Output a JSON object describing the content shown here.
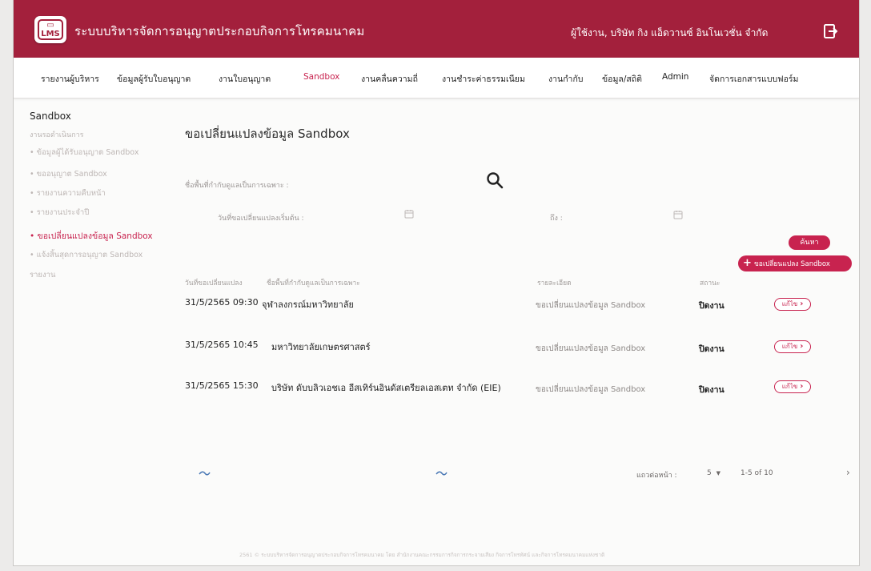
{
  "app": {
    "title": "ระบบบริหารจัดการอนุญาตประกอบกิจการโทรคมนาคม",
    "user": "ผู้ใช้งาน, บริษัท กิง แอ็ดวานซ์ อินโนเวชั่น จำกัด",
    "logo_text": "LMS"
  },
  "nav": {
    "items": [
      "รายงานผู้บริหาร",
      "ข้อมูลผู้รับใบอนุญาต",
      "งานใบอนุญาต",
      "Sandbox",
      "งานคลื่นความถี่",
      "งานชำระค่าธรรมเนียม",
      "งานกำกับ",
      "ข้อมูล/สถิติ",
      "Admin",
      "จัดการเอกสารแบบฟอร์ม"
    ],
    "active": "Sandbox"
  },
  "sidebar": {
    "title": "Sandbox",
    "section": "งานรอดำเนินการ",
    "items": [
      "• ข้อมูลผู้ได้รับอนุญาต Sandbox",
      "• ขออนุญาต Sandbox",
      "• รายงานความคืบหน้า",
      "• รายงานประจำปี",
      "• ขอเปลี่ยนแปลงข้อมูล Sandbox",
      "• แจ้งสิ้นสุดการอนุญาต Sandbox"
    ],
    "report": "รายงาน"
  },
  "main": {
    "title": "ขอเปลี่ยนแปลงข้อมูล Sandbox",
    "filters": {
      "area_label": "ชื่อพื้นที่กำกับดูแลเป็นการเฉพาะ :",
      "start_date_label": "วันที่ขอเปลี่ยนแปลงเริ่มต้น :",
      "end_date_label": "ถึง :"
    },
    "search_button": "ค้นหา",
    "add_button": "ขอเปลี่ยนแปลง Sandbox",
    "columns": [
      "วันที่ขอเปลี่ยนแปลง",
      "ชื่อพื้นที่กำกับดูแลเป็นการเฉพาะ",
      "รายละเอียด",
      "สถานะ"
    ],
    "rows": [
      {
        "date": "31/5/2565 09:30",
        "name": "จุฬาลงกรณ์มหาวิทยาลัย",
        "detail": "ขอเปลี่ยนแปลงข้อมูล Sandbox",
        "status": "ปิดงาน",
        "action": "แก้ไข"
      },
      {
        "date": "31/5/2565 10:45",
        "name": "มหาวิทยาลัยเกษตรศาสตร์",
        "detail": "ขอเปลี่ยนแปลงข้อมูล Sandbox",
        "status": "ปิดงาน",
        "action": "แก้ไข"
      },
      {
        "date": "31/5/2565 15:30",
        "name": "บริษัท ดับบลิวเอชเอ อีสเทิร์นอินดัสเตรียลเอสเตท จำกัด (EIE)",
        "detail": "ขอเปลี่ยนแปลงข้อมูล Sandbox",
        "status": "ปิดงาน",
        "action": "แก้ไข"
      }
    ],
    "pagination": {
      "rows_label": "แถวต่อหน้า :",
      "per_page": "5",
      "range": "1-5 of 10",
      "next": "›"
    }
  },
  "footer": "2561 © ระบบบริหารจัดการอนุญาตประกอบกิจการโทรคมนาคม โดย สำนักงานคณะกรรมการกิจการกระจายเสียง กิจการโทรทัศน์ และกิจการโทรคมนาคมแห่งชาติ",
  "colors": {
    "brand": "#a3203c",
    "accent": "#c8234f"
  }
}
